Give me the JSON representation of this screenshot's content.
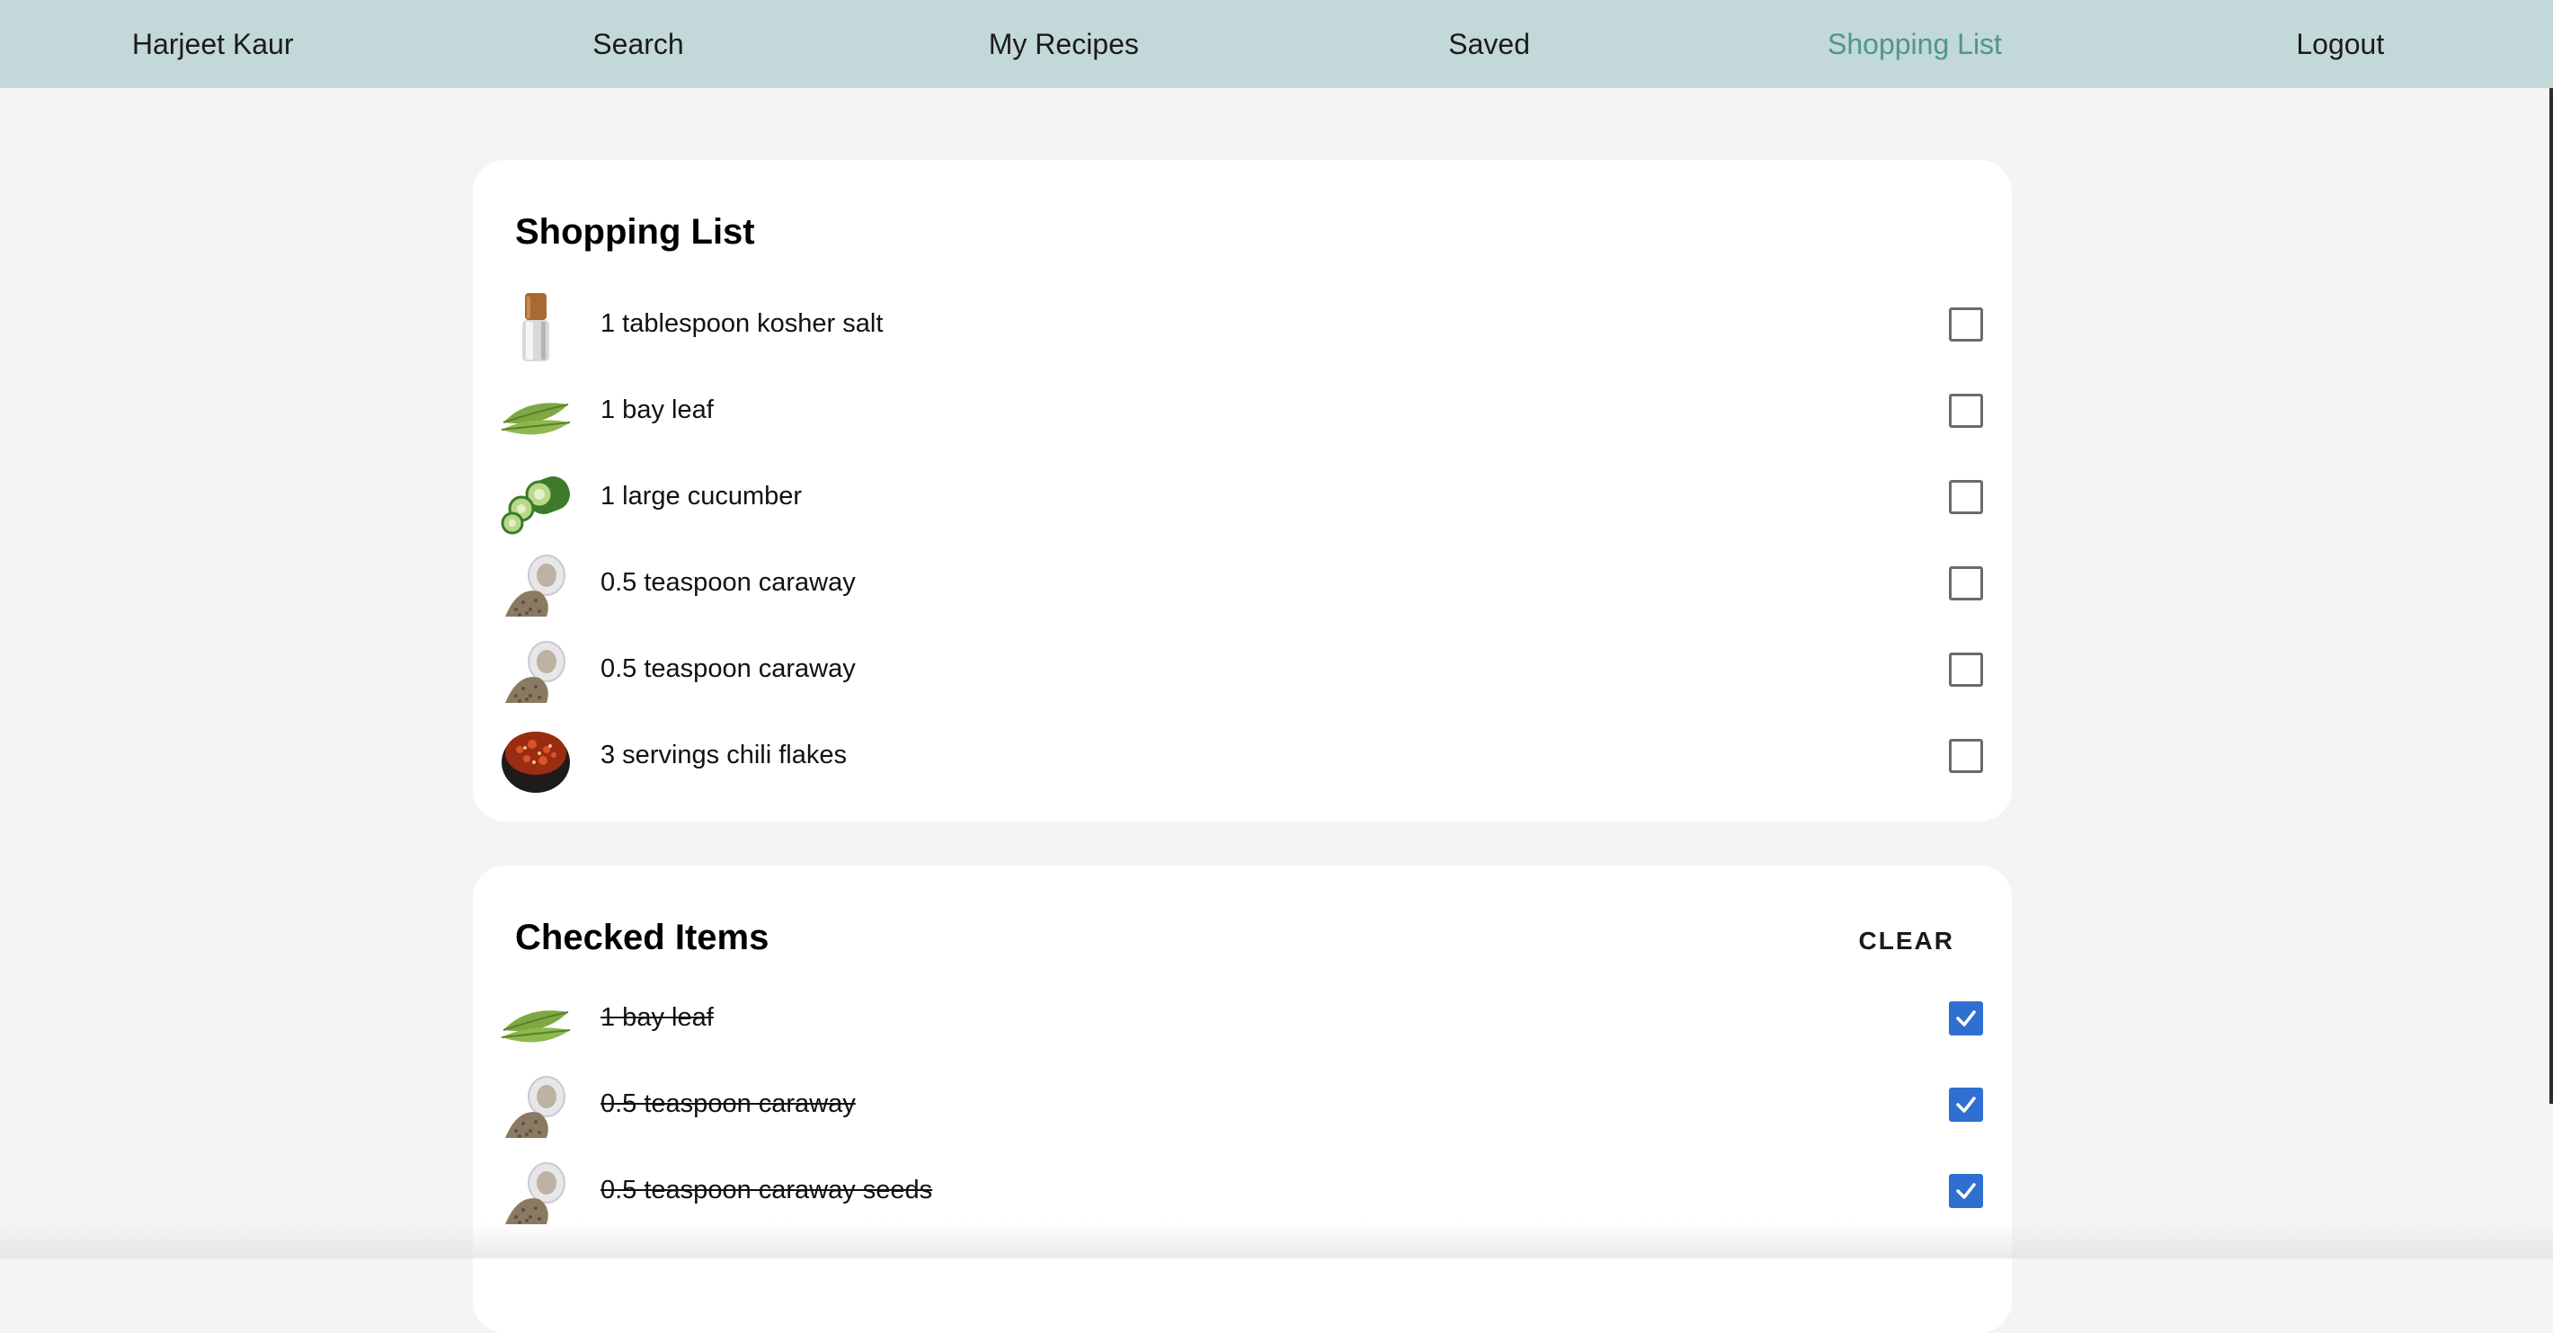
{
  "nav": {
    "items": [
      {
        "label": "Harjeet Kaur"
      },
      {
        "label": "Search"
      },
      {
        "label": "My Recipes"
      },
      {
        "label": "Saved"
      },
      {
        "label": "Shopping List"
      },
      {
        "label": "Logout"
      }
    ],
    "active": "Shopping List",
    "active_color": "#4f9593",
    "background": "#c3d8d8"
  },
  "shopping_list": {
    "title": "Shopping List",
    "items": [
      {
        "label": "1 tablespoon kosher salt",
        "icon": "salt-grinder-icon"
      },
      {
        "label": "1 bay leaf",
        "icon": "bay-leaf-icon"
      },
      {
        "label": "1 large cucumber",
        "icon": "cucumber-icon"
      },
      {
        "label": "0.5 teaspoon caraway",
        "icon": "caraway-seeds-icon"
      },
      {
        "label": "0.5 teaspoon caraway",
        "icon": "caraway-seeds-icon"
      },
      {
        "label": "3 servings chili flakes",
        "icon": "chili-flakes-icon"
      }
    ]
  },
  "checked_items": {
    "title": "Checked Items",
    "clear_label": "CLEAR",
    "checkbox_color": "#2f6fd1",
    "items": [
      {
        "label": "1 bay leaf",
        "icon": "bay-leaf-icon"
      },
      {
        "label": "0.5 teaspoon caraway",
        "icon": "caraway-seeds-icon"
      },
      {
        "label": "0.5 teaspoon caraway seeds",
        "icon": "caraway-seeds-icon"
      }
    ]
  }
}
